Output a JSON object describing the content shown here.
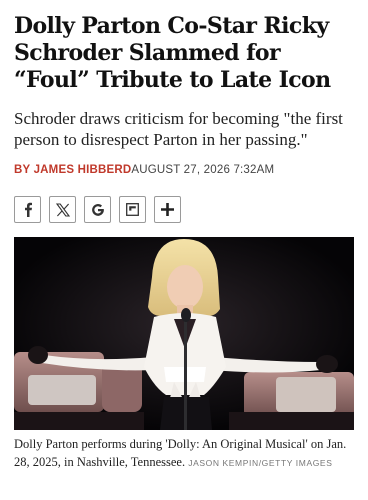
{
  "article": {
    "headline": "Dolly Parton Co-Star Ricky Schroder Slammed for “Foul” Tribute to Late Icon",
    "dek": "Schroder draws criticism for becoming \"the first person to disrespect Parton in her passing.\"",
    "byline": {
      "author": "BY JAMES HIBBERD",
      "date": "AUGUST 27, 2026 7:32AM"
    }
  },
  "share_buttons": [
    {
      "icon": "facebook-icon"
    },
    {
      "icon": "x-icon"
    },
    {
      "icon": "google-icon"
    },
    {
      "icon": "flipboard-icon"
    },
    {
      "icon": "plus-icon"
    }
  ],
  "photo": {
    "caption": "Dolly Parton performs during 'Dolly: An Original Musical' on Jan. 28, 2025, in Nashville, Tennessee.",
    "credit": "JASON KEMPIN/GETTY IMAGES"
  }
}
